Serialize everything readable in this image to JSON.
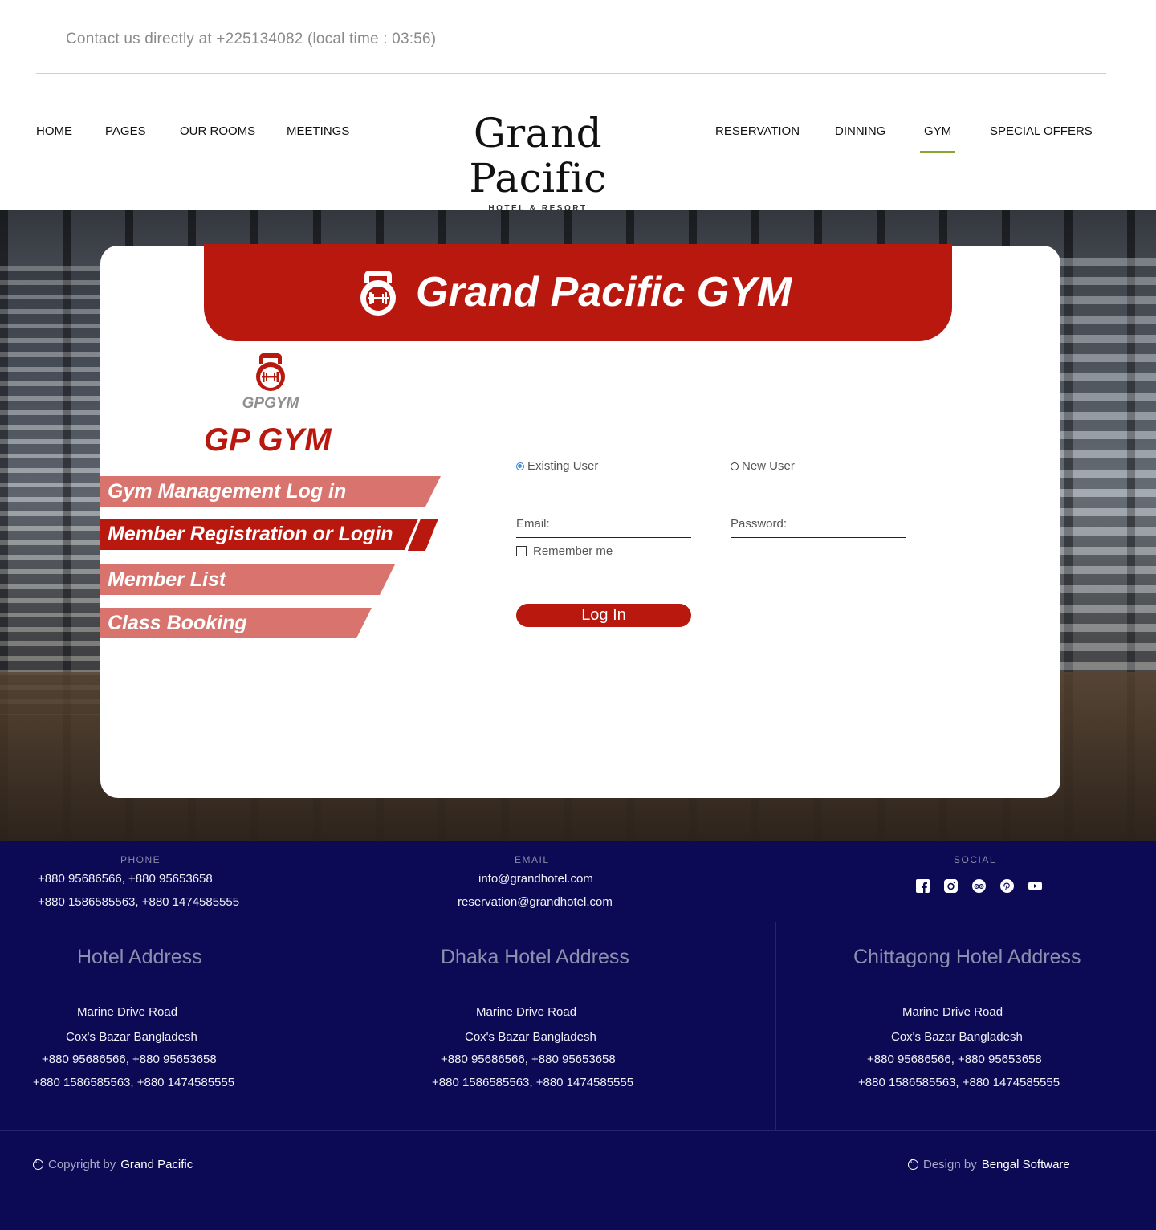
{
  "topbar": {
    "contact": "Contact  us directly at +225134082 (local time : 03:56)"
  },
  "nav": {
    "left": [
      {
        "label": "HOME"
      },
      {
        "label": "PAGES"
      },
      {
        "label": "OUR ROOMS"
      },
      {
        "label": "MEETINGS"
      }
    ],
    "right": [
      {
        "label": "RESERVATION"
      },
      {
        "label": "DINNING"
      },
      {
        "label": "GYM"
      },
      {
        "label": "SPECIAL OFFERS"
      }
    ],
    "active": "GYM",
    "active_color": "#8aa632"
  },
  "brand": {
    "title": "Grand Pacific",
    "subtitle": "HOTEL & RESORT"
  },
  "gym": {
    "banner_title": "Grand Pacific GYM",
    "banner_icon": "kettlebell-icon",
    "logo_text": "GPGYM",
    "title": "GP GYM",
    "accent": "#b8180e",
    "menu": [
      {
        "label": "Gym Management Log in"
      },
      {
        "label": "Member Registration or Login"
      },
      {
        "label": "Member List"
      },
      {
        "label": "Class Booking"
      }
    ],
    "selected_menu": "Member Registration or Login"
  },
  "form": {
    "radio_existing": "Existing User",
    "radio_new": "New User",
    "selected": "Existing User",
    "email_label": "Email:",
    "password_label": "Password:",
    "remember": "Remember me",
    "login": "Log In"
  },
  "footer": {
    "phone_label": "PHONE",
    "phone_1": "+880 95686566, +880 95653658",
    "phone_2": "+880 1586585563, +880 1474585555",
    "email_label": "EMAIL",
    "email_1": "info@grandhotel.com",
    "email_2": "reservation@grandhotel.com",
    "social_label": "SOCIAL",
    "social_icons": [
      "facebook-icon",
      "instagram-icon",
      "tripadvisor-icon",
      "pinterest-icon",
      "youtube-icon"
    ],
    "addresses": [
      {
        "title": "Hotel Address",
        "line1": "Marine Drive Road",
        "line2": "Cox's Bazar Bangladesh",
        "line3": "+880 95686566, +880 95653658",
        "line4": "+880 1586585563, +880 1474585555"
      },
      {
        "title": "Dhaka Hotel Address",
        "line1": "Marine Drive Road",
        "line2": "Cox's Bazar Bangladesh",
        "line3": "+880 95686566, +880 95653658",
        "line4": "+880 1586585563, +880 1474585555"
      },
      {
        "title": "Chittagong Hotel Address",
        "line1": "Marine Drive Road",
        "line2": "Cox's Bazar Bangladesh",
        "line3": "+880 95686566, +880 95653658",
        "line4": "+880 1586585563, +880 1474585555"
      }
    ],
    "copyright_prefix": "Copyright by",
    "copyright_name": "Grand Pacific",
    "design_prefix": "Design by",
    "design_name": "Bengal Software",
    "background": "#0c0a55"
  }
}
